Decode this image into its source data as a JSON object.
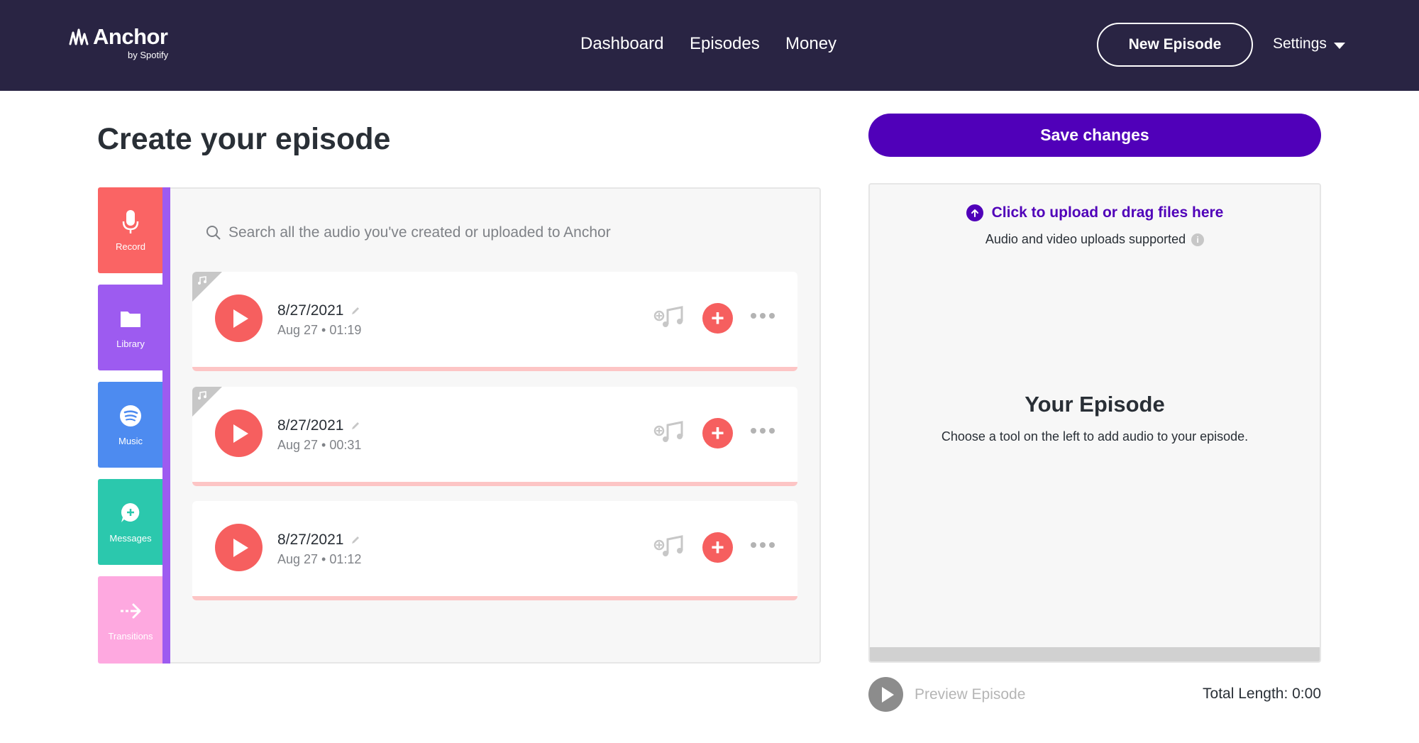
{
  "header": {
    "logo_word": "Anchor",
    "logo_sub": "by Spotify",
    "nav": [
      "Dashboard",
      "Episodes",
      "Money"
    ],
    "new_episode_label": "New Episode",
    "settings_label": "Settings"
  },
  "page_title": "Create your episode",
  "save_label": "Save changes",
  "tools": [
    {
      "label": "Record",
      "icon": "microphone-icon",
      "color": "#fa6464"
    },
    {
      "label": "Library",
      "icon": "folder-icon",
      "color": "#9d5bf0"
    },
    {
      "label": "Music",
      "icon": "spotify-icon",
      "color": "#4d8bf0"
    },
    {
      "label": "Messages",
      "icon": "message-icon",
      "color": "#2bc8ad"
    },
    {
      "label": "Transitions",
      "icon": "arrow-icon",
      "color": "#fea9e0"
    }
  ],
  "library": {
    "search_placeholder": "Search all the audio you've created or uploaded to Anchor",
    "clips": [
      {
        "title": "8/27/2021",
        "meta": "Aug 27 • 01:19",
        "has_music_corner": true
      },
      {
        "title": "8/27/2021",
        "meta": "Aug 27 • 00:31",
        "has_music_corner": true
      },
      {
        "title": "8/27/2021",
        "meta": "Aug 27 • 01:12",
        "has_music_corner": false
      }
    ]
  },
  "episode": {
    "upload_link": "Click to upload or drag files here",
    "upload_sub": "Audio and video uploads supported",
    "title": "Your Episode",
    "subtitle": "Choose a tool on the left to add audio to your episode.",
    "preview_label": "Preview Episode",
    "total_length": "Total Length: 0:00"
  },
  "colors": {
    "header_bg": "#292443",
    "accent": "#5000b9",
    "clip_red": "#f65f5f"
  }
}
